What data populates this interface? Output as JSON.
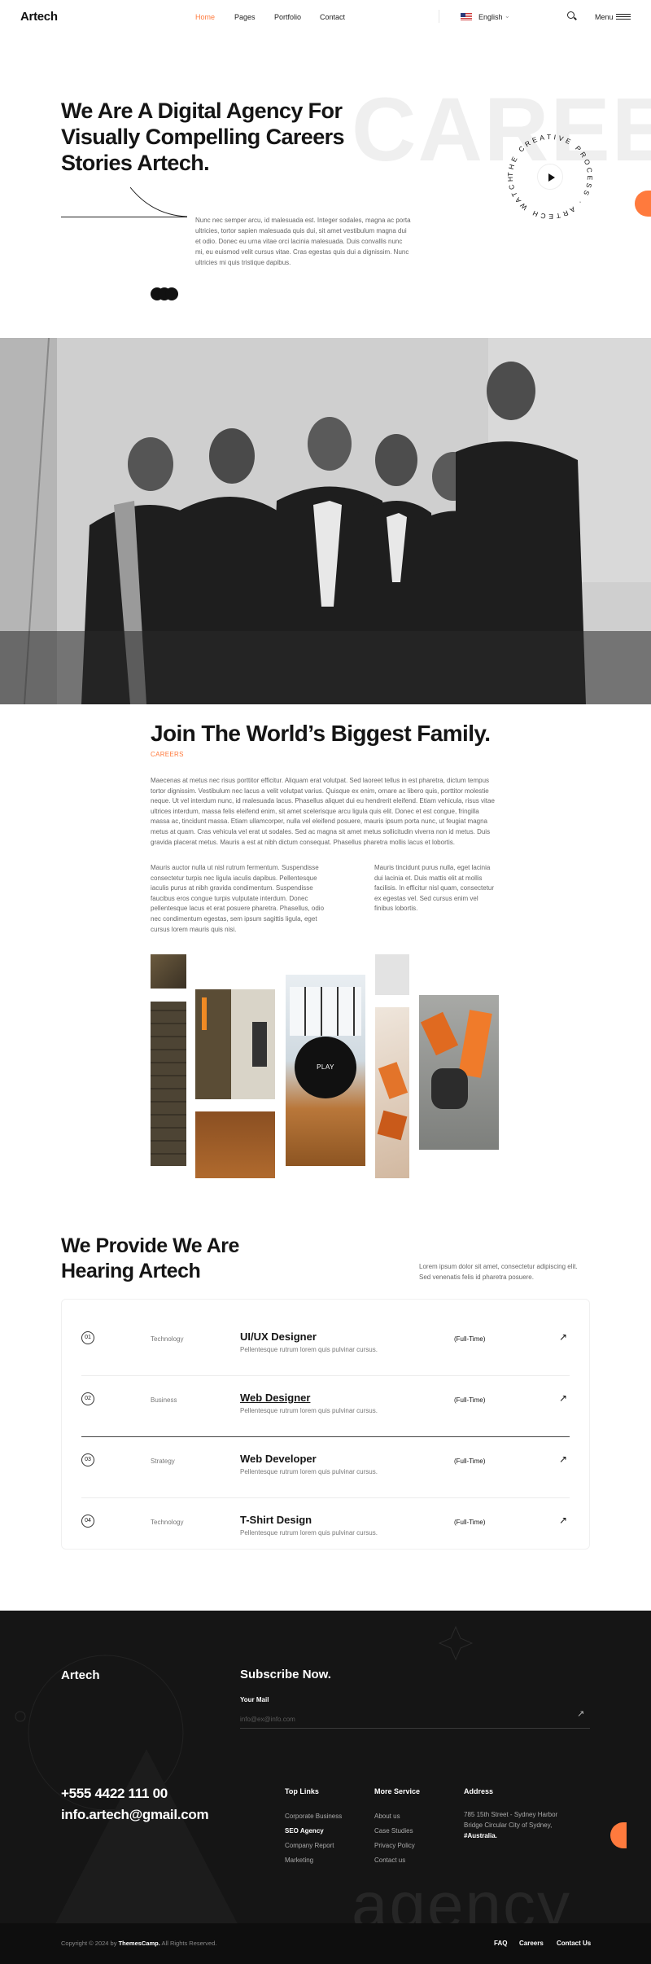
{
  "header": {
    "logo": "Artech",
    "nav": [
      {
        "label": "Home",
        "active": true
      },
      {
        "label": "Pages",
        "active": false
      },
      {
        "label": "Portfolio",
        "active": false
      },
      {
        "label": "Contact",
        "active": false
      }
    ],
    "language": "English",
    "menu_label": "Menu"
  },
  "hero": {
    "title": "We Are A Digital Agency For Visually Compelling Careers Stories Artech.",
    "bg_word": "CAREE",
    "paragraph": "Nunc nec semper arcu, id malesuada est. Integer sodales, magna ac porta ultricies, tortor sapien malesuada quis dui, sit amet vestibulum magna dui et odio. Donec eu urna vitae orci lacinia malesuada. Duis convallis nunc mi, eu euismod velit cursus vitae. Cras egestas quis dui a dignissim. Nunc ultricies mi quis tristique dapibus.",
    "circle_text": "THE CREATIVE PROCESS · ARTECH WATCH ·"
  },
  "family": {
    "title": "Join The World’s Biggest Family.",
    "tag": "CAREERS",
    "paragraph": "Maecenas at metus nec risus porttitor efficitur. Aliquam erat volutpat. Sed laoreet tellus in est pharetra, dictum tempus tortor dignissim. Vestibulum nec lacus a velit volutpat varius. Quisque ex enim, ornare ac libero quis, porttitor molestie neque. Ut vel interdum nunc, id malesuada lacus. Phasellus aliquet dui eu hendrerit eleifend. Etiam vehicula, risus vitae ultrices interdum, massa felis eleifend enim, sit amet scelerisque arcu ligula quis elit. Donec et est congue, fringilla massa ac, tincidunt massa. Etiam ullamcorper, nulla vel eleifend posuere, mauris ipsum porta nunc, ut feugiat magna metus at quam. Cras vehicula vel erat ut sodales. Sed ac magna sit amet metus sollicitudin viverra non id metus. Duis gravida placerat metus. Mauris a est at nibh dictum consequat. Phasellus pharetra mollis lacus et lobortis.",
    "col1": "Mauris auctor nulla ut nisl rutrum fermentum. Suspendisse consectetur turpis nec ligula iaculis dapibus. Pellentesque iaculis purus at nibh gravida condimentum. Suspendisse faucibus eros congue turpis vulputate interdum. Donec pellentesque lacus et erat posuere pharetra. Phasellus, odio nec condimentum egestas, sem ipsum sagittis ligula, eget cursus lorem mauris quis nisi.",
    "col2": "Mauris tincidunt purus nulla, eget lacinia dui lacinia et. Duis mattis elit at mollis facilisis. In efficitur nisl quam, consectetur ex egestas vel. Sed cursus enim vel finibus lobortis.",
    "play_label": "PLAY"
  },
  "jobs": {
    "title": "We Provide We Are Hearing Artech",
    "description": "Lorem ipsum dolor sit amet, consectetur adipiscing elit. Sed venenatis felis id pharetra posuere.",
    "items": [
      {
        "num": "01",
        "category": "Technology",
        "title": "UI/UX Designer",
        "subtitle": "Pellentesque rutrum lorem quis pulvinar cursus.",
        "type": "(Full-Time)"
      },
      {
        "num": "02",
        "category": "Business",
        "title": "Web Designer",
        "subtitle": "Pellentesque rutrum lorem quis pulvinar cursus.",
        "type": "(Full-Time)"
      },
      {
        "num": "03",
        "category": "Strategy",
        "title": "Web Developer",
        "subtitle": "Pellentesque rutrum lorem quis pulvinar cursus.",
        "type": "(Full-Time)"
      },
      {
        "num": "04",
        "category": "Technology",
        "title": "T-Shirt Design",
        "subtitle": "Pellentesque rutrum lorem quis pulvinar cursus.",
        "type": "(Full-Time)"
      }
    ]
  },
  "footer": {
    "logo": "Artech",
    "subscribe_title": "Subscribe Now.",
    "mail_label": "Your Mail",
    "mail_placeholder": "info@ex@info.com",
    "phone": "+555 4422 111 00",
    "email": "info.artech@gmail.com",
    "top_links_head": "Top Links",
    "top_links": [
      "Corporate Business",
      "SEO Agency",
      "Company Report",
      "Marketing"
    ],
    "more_service_head": "More Service",
    "more_service": [
      "About us",
      "Case Studies",
      "Privacy Policy",
      "Contact us"
    ],
    "address_head": "Address",
    "address_line": "785 15th Street - Sydney Harbor Bridge Circular City of Sydney,",
    "address_bold": "#Australia.",
    "bg_word": "agency",
    "copyright_prefix": "Copyright © 2024 by",
    "copyright_brand": "ThemesCamp.",
    "copyright_suffix": "All Rights Reserved.",
    "bottom_links": [
      "FAQ",
      "Careers",
      "Contact Us"
    ]
  },
  "colors": {
    "accent": "#ff7a3d",
    "dark": "#151515"
  }
}
